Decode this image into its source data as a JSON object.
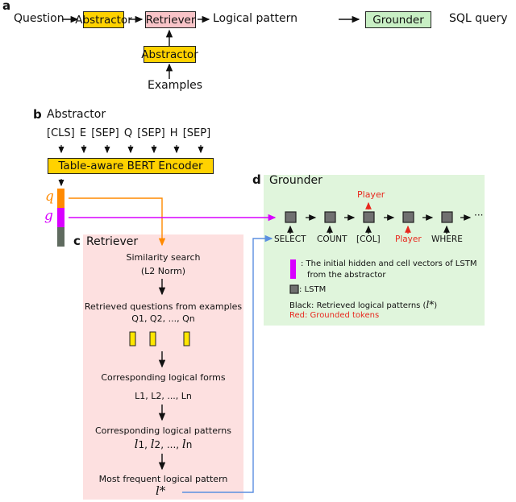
{
  "panel_a": {
    "letter": "a",
    "input": "Question",
    "abstractor": "Abstractor",
    "retriever": "Retriever",
    "logical_pattern": "Logical pattern",
    "grounder": "Grounder",
    "output": "SQL query",
    "examples_abstractor": "Abstractor",
    "examples": "Examples"
  },
  "panel_b": {
    "letter": "b",
    "title": "Abstractor",
    "tokens": [
      "[CLS]",
      "E",
      "[SEP]",
      "Q",
      "[SEP]",
      "H",
      "[SEP]"
    ],
    "encoder": "Table-aware BERT Encoder",
    "vector_q": "q",
    "vector_g": "g"
  },
  "panel_c": {
    "letter": "c",
    "title": "Retriever",
    "step1_line1": "Similarity search",
    "step1_line2": "(L2 Norm)",
    "step2_line1": "Retrieved questions from examples",
    "step2_line2": "Q1, Q2, ..., Qn",
    "step3_line1": "Corresponding logical forms",
    "step3_line2": "L1, L2, ..., Ln",
    "step4_line1": "Corresponding logical patterns",
    "step4_patterns": [
      {
        "sym": "l",
        "sub": "1"
      },
      {
        "sym": "l",
        "sub": "2"
      },
      {
        "sym": "l",
        "sub": "n"
      }
    ],
    "step4_ellipsis": "...,",
    "step5_line1": "Most frequent logical pattern",
    "step5_symbol": "l*"
  },
  "panel_d": {
    "letter": "d",
    "title": "Grounder",
    "inputs": [
      {
        "label": "SELECT",
        "grounded": false
      },
      {
        "label": "COUNT",
        "grounded": false
      },
      {
        "label": "[COL]",
        "grounded": false
      },
      {
        "label": "Player",
        "grounded": true
      },
      {
        "label": "WHERE",
        "grounded": false
      }
    ],
    "output_above_col": "Player",
    "ellipsis": "···",
    "legend": {
      "hidden_line1": ": The initial hidden and cell vectors of LSTM",
      "hidden_line2": "from the abstractor",
      "lstm": ": LSTM",
      "black": "Black: Retrieved logical patterns (",
      "black_sym": "l*",
      "black_end": ")",
      "red": "Red: Grounded tokens"
    }
  },
  "colors": {
    "yellow": "#ffd200",
    "pink_box": "#f9c4c8",
    "green_box": "#c8efc4",
    "retriever_bg": "#fde0e0",
    "grounder_bg": "#e0f5dc",
    "orange": "#ff8a00",
    "magenta": "#d800ff",
    "gray_bar": "#5f6b5f",
    "blue_line": "#5b8fe0",
    "red_text": "#e8281e",
    "lstm_cell": "#707070"
  }
}
